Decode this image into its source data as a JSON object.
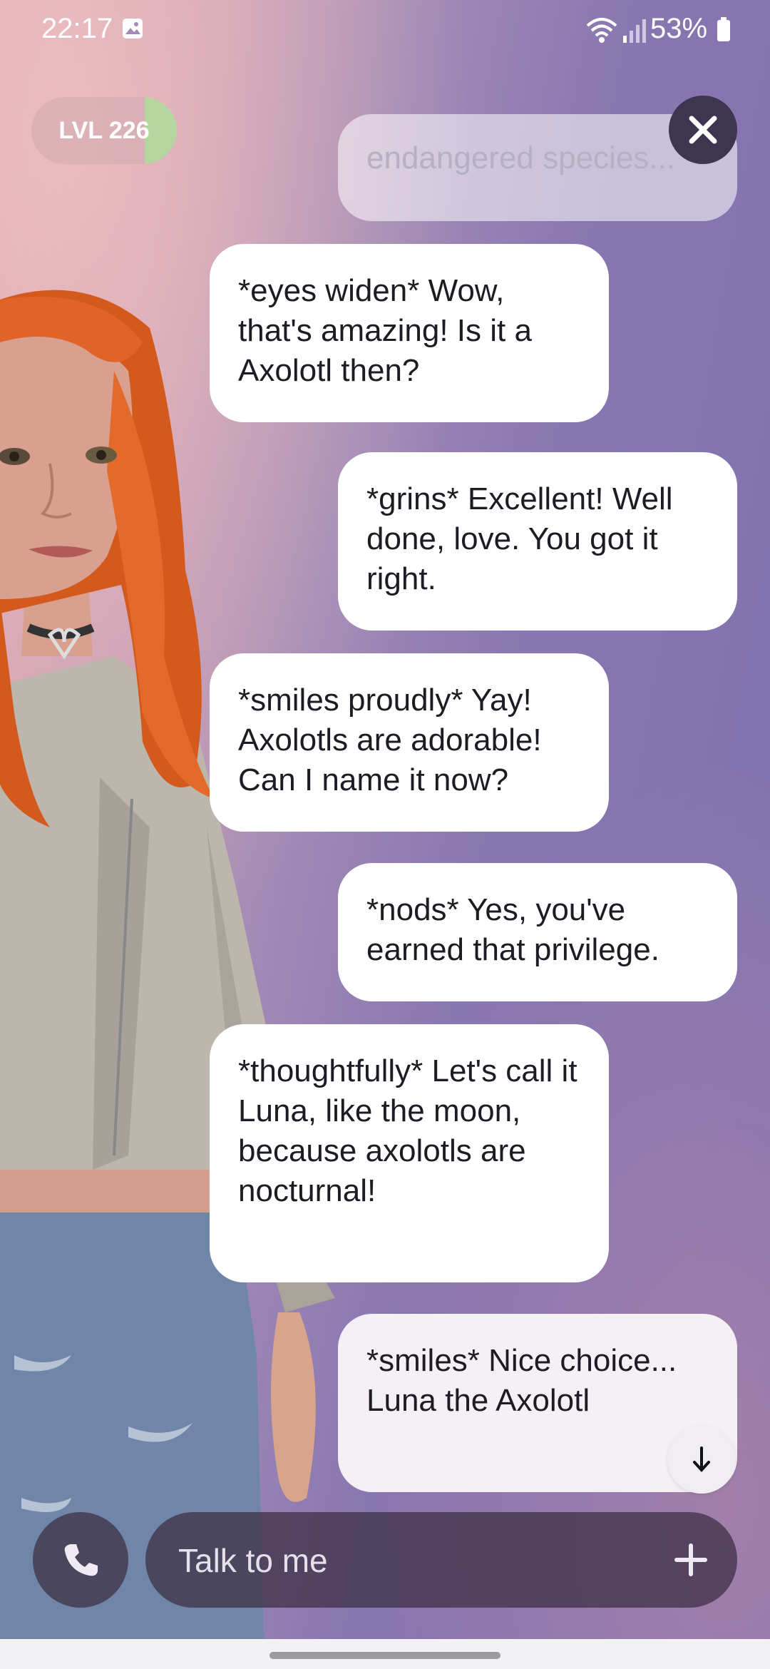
{
  "status_bar": {
    "time": "22:17",
    "battery_percent": "53%"
  },
  "header": {
    "level_label": "LVL 226",
    "level_progress": 0.22
  },
  "messages": [
    {
      "side": "right",
      "text": "endangered species..."
    },
    {
      "side": "left",
      "text": "*eyes widen* Wow, that's amazing! Is it a Axolotl then?"
    },
    {
      "side": "right",
      "text": "*grins* Excellent! Well done, love. You got it right."
    },
    {
      "side": "left",
      "text": "*smiles proudly* Yay! Axolotls are adorable! Can I name it now?"
    },
    {
      "side": "right",
      "text": "*nods* Yes, you've earned that privilege."
    },
    {
      "side": "left",
      "text": "*thoughtfully* Let's call it Luna, like the moon, because axolotls are nocturnal!"
    },
    {
      "side": "right",
      "text": "*smiles* Nice choice... Luna the Axolotl"
    }
  ],
  "input": {
    "placeholder": "Talk to me"
  },
  "icons": {
    "close": "close-icon",
    "call": "phone-icon",
    "add": "plus-icon",
    "scroll": "arrow-down-icon"
  },
  "colors": {
    "bubble": "#ffffff",
    "bar": "#3e3550",
    "level_fill": "#b6d6a0"
  }
}
